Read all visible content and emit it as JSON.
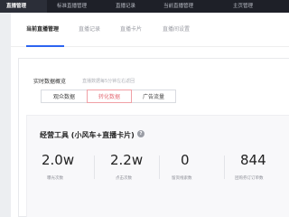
{
  "topnav": {
    "items": [
      "直播管理",
      "标准直播管理",
      "直播记录",
      "当前直播管理",
      "主页管理"
    ],
    "active_index": 0
  },
  "subtabs": {
    "items": [
      "当前直播管理",
      "直播记录",
      "直播卡片",
      "直播间设置"
    ],
    "active_index": 0
  },
  "realtime": {
    "title": "实时数据概览",
    "note": "直播数据每5分钟左右返回",
    "segments": [
      "观众数据",
      "转化数据",
      "广告流量"
    ],
    "active_segment": 1
  },
  "tools": {
    "title": "经营工具 (小风车+直播卡片)",
    "help_icon": "question-circle-icon",
    "metrics": [
      {
        "value": "2.0w",
        "label": "曝光次数"
      },
      {
        "value": "2.2w",
        "label": "点击次数"
      },
      {
        "value": "0",
        "label": "留资线索数"
      },
      {
        "value": "844",
        "label": "团购券订订单数"
      }
    ]
  },
  "colors": {
    "topbar_bg": "#1e2028",
    "accent_blue": "#2d64f0",
    "active_segment": "#e5707a"
  }
}
